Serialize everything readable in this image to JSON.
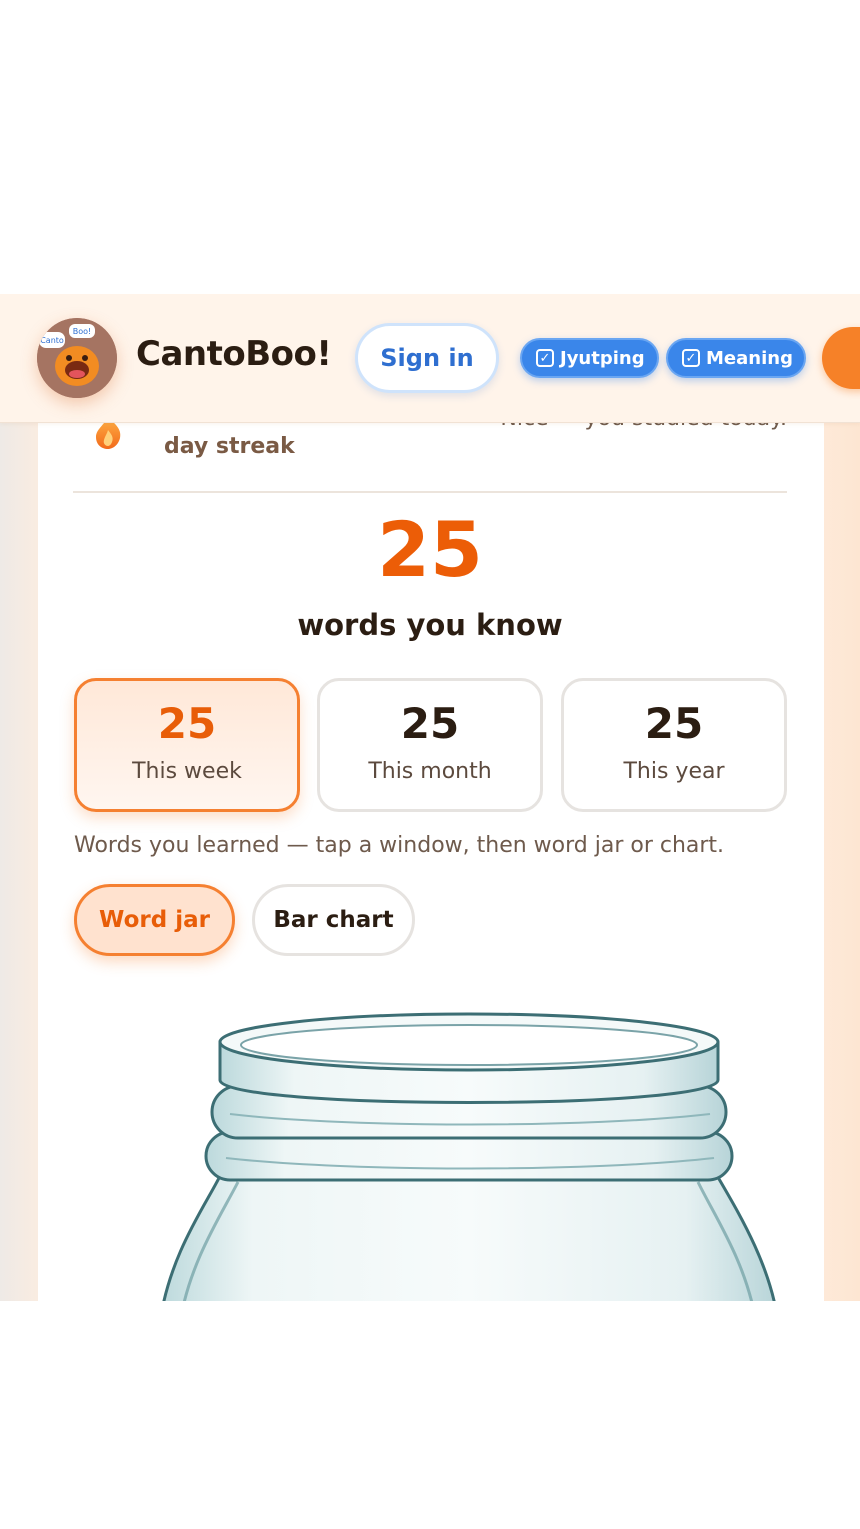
{
  "header": {
    "brand": "CantoBoo!",
    "logo_text_left": "Canto",
    "logo_text_right": "Boo!",
    "signin_label": "Sign in",
    "toggles": [
      {
        "label": "Jyutping",
        "checked": true,
        "icon": "checkbox-icon"
      },
      {
        "label": "Meaning",
        "checked": true,
        "icon": "checkbox-icon"
      }
    ]
  },
  "streak": {
    "label": "day streak",
    "message": "Nice — you studied today.",
    "icon": "flame-icon"
  },
  "totals": {
    "count": "25",
    "label": "words you know"
  },
  "windows": [
    {
      "count": "25",
      "label": "This week",
      "active": true
    },
    {
      "count": "25",
      "label": "This month",
      "active": false
    },
    {
      "count": "25",
      "label": "This year",
      "active": false
    }
  ],
  "hint": "Words you learned — tap a window, then word jar or chart.",
  "view_toggle": {
    "word_jar": "Word jar",
    "bar_chart": "Bar chart",
    "selected": "Word jar"
  },
  "colors": {
    "accent": "#ec5d07",
    "toggle_blue": "#3a86ea",
    "signin_blue": "#2f6fd0",
    "text_dark": "#2b1d12"
  }
}
